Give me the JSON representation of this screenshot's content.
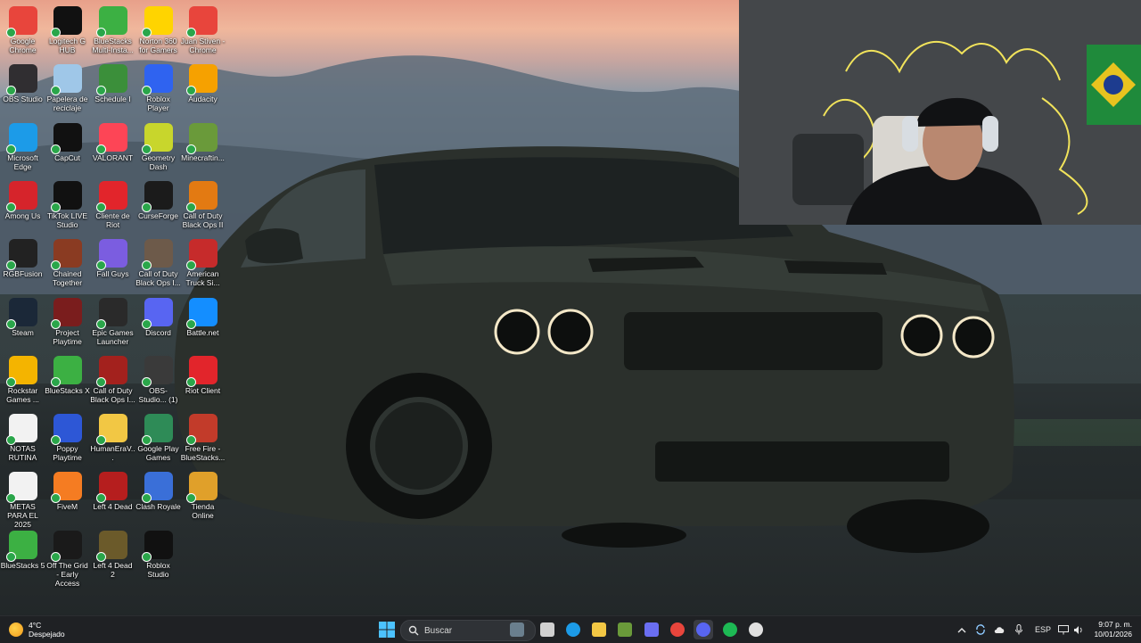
{
  "desktop": {
    "icons": [
      {
        "label": "Google Chrome",
        "icon": "chrome-icon",
        "color": "#e8453c"
      },
      {
        "label": "Logitech G HUB",
        "icon": "logitech-g-icon",
        "color": "#111111"
      },
      {
        "label": "BlueStacks Multi-Insta...",
        "icon": "bluestacks-multi-icon",
        "color": "#3cb043"
      },
      {
        "label": "Norton 360 for Gamers",
        "icon": "norton-icon",
        "color": "#ffd400"
      },
      {
        "label": "Juan Stiven - Chrome",
        "icon": "chrome-profile-icon",
        "color": "#e8453c"
      },
      {
        "label": "OBS Studio",
        "icon": "obs-icon",
        "color": "#302e31"
      },
      {
        "label": "Papelera de reciclaje",
        "icon": "recycle-bin-icon",
        "color": "#9fc7e8"
      },
      {
        "label": "Schedule I",
        "icon": "schedule-i-icon",
        "color": "#3b8f3a"
      },
      {
        "label": "Roblox Player",
        "icon": "roblox-player-icon",
        "color": "#2f63f0"
      },
      {
        "label": "Audacity",
        "icon": "audacity-icon",
        "color": "#f6a100"
      },
      {
        "label": "Microsoft Edge",
        "icon": "edge-icon",
        "color": "#1c9be8"
      },
      {
        "label": "CapCut",
        "icon": "capcut-icon",
        "color": "#111111"
      },
      {
        "label": "VALORANT",
        "icon": "valorant-icon",
        "color": "#fd4556"
      },
      {
        "label": "Geometry Dash",
        "icon": "geometry-dash-icon",
        "color": "#c8d62c"
      },
      {
        "label": "Minecraftin...",
        "icon": "minecraft-icon",
        "color": "#6a9a3a"
      },
      {
        "label": "Among Us",
        "icon": "among-us-icon",
        "color": "#d6242b"
      },
      {
        "label": "TikTok LIVE Studio",
        "icon": "tiktok-icon",
        "color": "#111111"
      },
      {
        "label": "Cliente de Riot",
        "icon": "riot-client-icon",
        "color": "#e2252b"
      },
      {
        "label": "CurseForge",
        "icon": "curseforge-icon",
        "color": "#1b1b1b"
      },
      {
        "label": "Call of Duty Black Ops II",
        "icon": "cod-bo2-icon",
        "color": "#e37a12"
      },
      {
        "label": "RGBFusion",
        "icon": "rgbfusion-icon",
        "color": "#222222"
      },
      {
        "label": "Chained Together",
        "icon": "chained-together-icon",
        "color": "#8a3b22"
      },
      {
        "label": "Fall Guys",
        "icon": "fall-guys-icon",
        "color": "#7b5de0"
      },
      {
        "label": "Call of Duty Black Ops I...",
        "icon": "cod-bo-icon",
        "color": "#6d5a4a"
      },
      {
        "label": "American Truck Si...",
        "icon": "american-truck-icon",
        "color": "#c62b2b"
      },
      {
        "label": "Steam",
        "icon": "steam-icon",
        "color": "#1b2838"
      },
      {
        "label": "Project Playtime",
        "icon": "project-playtime-icon",
        "color": "#7a1d1d"
      },
      {
        "label": "Epic Games Launcher",
        "icon": "epic-games-icon",
        "color": "#2a2a2a"
      },
      {
        "label": "Discord",
        "icon": "discord-icon",
        "color": "#5865f2"
      },
      {
        "label": "Battle.net",
        "icon": "battlenet-icon",
        "color": "#148eff"
      },
      {
        "label": "Rockstar Games ...",
        "icon": "rockstar-icon",
        "color": "#f4b400"
      },
      {
        "label": "BlueStacks X",
        "icon": "bluestacks-x-icon",
        "color": "#3cb043"
      },
      {
        "label": "Call of Duty Black Ops I...",
        "icon": "cod-bo-red-icon",
        "color": "#a3211d"
      },
      {
        "label": "OBS-Studio... (1)",
        "icon": "obs-installer-icon",
        "color": "#3a3a3a"
      },
      {
        "label": "Riot Client",
        "icon": "riot-icon",
        "color": "#e2252b"
      },
      {
        "label": "NOTAS RUTINA",
        "icon": "text-file-icon",
        "color": "#f2f2f2"
      },
      {
        "label": "Poppy Playtime",
        "icon": "poppy-playtime-icon",
        "color": "#2d57d6"
      },
      {
        "label": "HumanEraV...",
        "icon": "folder-icon",
        "color": "#f2c744"
      },
      {
        "label": "Google Play Games",
        "icon": "google-play-games-icon",
        "color": "#2e8b57"
      },
      {
        "label": "Free Fire - BlueStacks...",
        "icon": "free-fire-icon",
        "color": "#c23b2a"
      },
      {
        "label": "METAS PARA EL 2025",
        "icon": "text-file-icon",
        "color": "#f2f2f2"
      },
      {
        "label": "FiveM",
        "icon": "fivem-icon",
        "color": "#f57c22"
      },
      {
        "label": "Left 4 Dead",
        "icon": "left4dead-icon",
        "color": "#b51e1e"
      },
      {
        "label": "Clash Royale",
        "icon": "clash-royale-icon",
        "color": "#3a6fd8"
      },
      {
        "label": "Tienda Online",
        "icon": "shortcut-icon",
        "color": "#e0a02a"
      },
      {
        "label": "BlueStacks 5",
        "icon": "bluestacks5-icon",
        "color": "#3cb043"
      },
      {
        "label": "Off The Grid - Early Access",
        "icon": "off-the-grid-icon",
        "color": "#1a1a1a"
      },
      {
        "label": "Left 4 Dead 2",
        "icon": "left4dead2-icon",
        "color": "#6b5a2a"
      },
      {
        "label": "Roblox Studio",
        "icon": "roblox-studio-icon",
        "color": "#111111"
      }
    ]
  },
  "weather": {
    "temp": "4°C",
    "condition": "Despejado"
  },
  "taskbar": {
    "search_placeholder": "Buscar",
    "apps": [
      {
        "name": "widget-app",
        "color": "#6a7f8e"
      },
      {
        "name": "task-view",
        "color": "#d0d0d0"
      },
      {
        "name": "edge",
        "color": "#1c9be8"
      },
      {
        "name": "file-explorer",
        "color": "#f2c744"
      },
      {
        "name": "minecraft",
        "color": "#6a9a3a"
      },
      {
        "name": "copilot",
        "color": "#6a6ef2"
      },
      {
        "name": "chrome",
        "color": "#e8453c"
      },
      {
        "name": "discord",
        "color": "#5865f2"
      },
      {
        "name": "spotify",
        "color": "#1db954"
      },
      {
        "name": "obs",
        "color": "#e0e0e0"
      }
    ]
  },
  "tray": {
    "language": "ESP",
    "time": "9:07 p. m.",
    "date": "10/01/2026"
  }
}
